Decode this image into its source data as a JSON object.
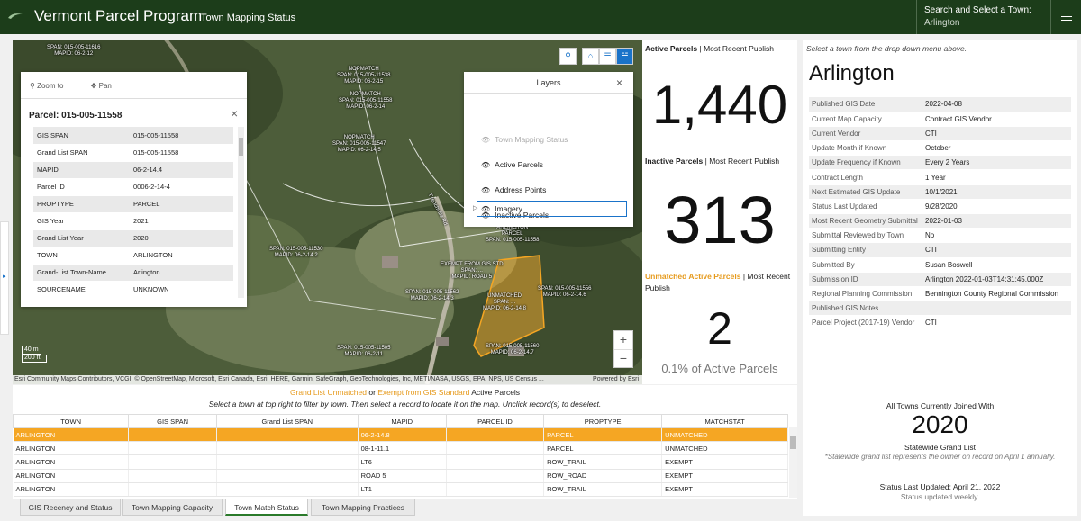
{
  "header": {
    "title": "Vermont Parcel Program",
    "subtitle": "Town Mapping Status",
    "town_select_label": "Search and Select a Town:",
    "town_select_value": "Arlington"
  },
  "map": {
    "tools": {
      "zoom_to": "Zoom to",
      "pan": "Pan"
    },
    "attribution": "Esri Community Maps Contributors, VCGI, © OpenStreetMap, Microsoft, Esri Canada, Esri, HERE, Garmin, SafeGraph, GeoTechnologies, Inc, METI/NASA, USGS, EPA, NPS, US Census ...",
    "powered_by": "Powered by Esri",
    "scale_metric": "40 m",
    "scale_imperial": "200 ft",
    "labels": [
      "SPAN: 015-005-11616\nMAPID: 06-2-12",
      "NOPMATCH\nSPAN: 015-005-11538\nMAPID: 06-2-15",
      "NOPMATCH\nSPAN: 015-005-11558\nMAPID: 06-2-14",
      "NOPMATCH\nSPAN: 015-005-11547\nMAPID: 06-2-14.5",
      "Frenchville Rd",
      "ARLINGTON\nPARCEL\nSPAN: 015-005-11558",
      "SPAN: 015-005-11530\nMAPID: 06-2-14.2",
      "EXEMPT FROM GIS STD\nSPAN: ...\nMAPID: ROAD 5",
      "UNMATCHED\nSPAN: ...\nMAPID: 06-2-14.8",
      "SPAN: 015-005-11556\nMAPID: 06-2-14.6",
      "SPAN: 015-005-11560\nMAPID: 06-2-14.7",
      "SPAN: 015-005-11505\nMAPID: 06-2-11",
      "SPAN: 015-005-11562\nMAPID: 06-2-14.3"
    ],
    "popup": {
      "title": "Parcel: 015-005-11558",
      "rows": [
        {
          "k": "GIS SPAN",
          "v": "015-005-11558"
        },
        {
          "k": "Grand List SPAN",
          "v": "015-005-11558"
        },
        {
          "k": "MAPID",
          "v": "06-2-14.4"
        },
        {
          "k": "Parcel ID",
          "v": "0006-2-14-4"
        },
        {
          "k": "PROPTYPE",
          "v": "PARCEL"
        },
        {
          "k": "GIS Year",
          "v": "2021"
        },
        {
          "k": "Grand List Year",
          "v": "2020"
        },
        {
          "k": "TOWN",
          "v": "ARLINGTON"
        },
        {
          "k": "Grand-List Town-Name",
          "v": "Arlington"
        },
        {
          "k": "SOURCENAME",
          "v": "UNKNOWN"
        }
      ]
    },
    "layers": {
      "title": "Layers",
      "items": [
        "Town Mapping Status",
        "Active Parcels",
        "Address Points",
        "Inactive Parcels",
        "Imagery"
      ]
    }
  },
  "stats": {
    "active_label": "Active Parcels",
    "recent": "| Most Recent Publish",
    "active_value": "1,440",
    "inactive_label": "Inactive Parcels",
    "inactive_value": "313",
    "unmatched_label": "Unmatched Active Parcels",
    "unmatched_recent": "| Most Recent Publish",
    "unmatched_value": "2",
    "unmatched_pct": "0.1% of Active Parcels"
  },
  "table": {
    "title_a": "Grand List Unmatched",
    "title_b": " or ",
    "title_c": "Exempt from GIS Standard",
    "title_d": " Active Parcels",
    "instructions": "Select a town at top right to filter by town. Then select a record to locate it on the map. Unclick record(s) to deselect.",
    "columns": [
      "TOWN",
      "GIS SPAN",
      "Grand List SPAN",
      "MAPID",
      "PARCEL ID",
      "PROPTYPE",
      "MATCHSTAT"
    ],
    "rows": [
      [
        "ARLINGTON",
        "",
        "",
        "06-2-14.8",
        "",
        "PARCEL",
        "UNMATCHED"
      ],
      [
        "ARLINGTON",
        "",
        "",
        "08-1-11.1",
        "",
        "PARCEL",
        "UNMATCHED"
      ],
      [
        "ARLINGTON",
        "",
        "",
        "LT6",
        "",
        "ROW_TRAIL",
        "EXEMPT"
      ],
      [
        "ARLINGTON",
        "",
        "",
        "ROAD 5",
        "",
        "ROW_ROAD",
        "EXEMPT"
      ],
      [
        "ARLINGTON",
        "",
        "",
        "LT1",
        "",
        "ROW_TRAIL",
        "EXEMPT"
      ]
    ]
  },
  "details": {
    "hint": "Select a town from the drop down menu above.",
    "town": "Arlington",
    "rows": [
      {
        "k": "Published GIS Date",
        "v": "2022-04-08"
      },
      {
        "k": "Current Map Capacity",
        "v": "Contract GIS Vendor"
      },
      {
        "k": "Current Vendor",
        "v": "CTI"
      },
      {
        "k": "Update Month if Known",
        "v": "October"
      },
      {
        "k": "Update Frequency if Known",
        "v": "Every 2 Years"
      },
      {
        "k": "Contract Length",
        "v": "1 Year"
      },
      {
        "k": "Next Estimated GIS Update",
        "v": "10/1/2021"
      },
      {
        "k": "Status Last Updated",
        "v": "9/28/2020"
      },
      {
        "k": "Most Recent Geometry Submittal",
        "v": "2022-01-03"
      },
      {
        "k": "Submittal Reviewed by Town",
        "v": "No"
      },
      {
        "k": "Submitting Entity",
        "v": "CTI"
      },
      {
        "k": "Submitted By",
        "v": "Susan Boswell"
      },
      {
        "k": "Submission ID",
        "v": "Arlington 2022-01-03T14:31:45.000Z"
      },
      {
        "k": "Regional Planning Commission",
        "v": "Bennington County Regional Commission"
      },
      {
        "k": "Published GIS Notes",
        "v": ""
      },
      {
        "k": "Parcel Project (2017-19) Vendor",
        "v": "CTI"
      }
    ],
    "joined_label": "All Towns Currently Joined With",
    "joined_year": "2020",
    "joined_sub": "Statewide Grand List",
    "joined_note": "*Statewide grand list represents the owner on record on April 1 annually.",
    "status_updated": "Status Last Updated: April 21, 2022",
    "status_freq": "Status updated weekly."
  },
  "tabs": [
    "GIS Recency and Status",
    "Town Mapping Capacity",
    "Town Match Status",
    "Town Mapping Practices"
  ],
  "active_tab": 2,
  "colors": {
    "header": "#1c3d1a",
    "accent": "#f5a623",
    "unmatched_text": "#e69a1c",
    "link": "#1a73c9"
  }
}
